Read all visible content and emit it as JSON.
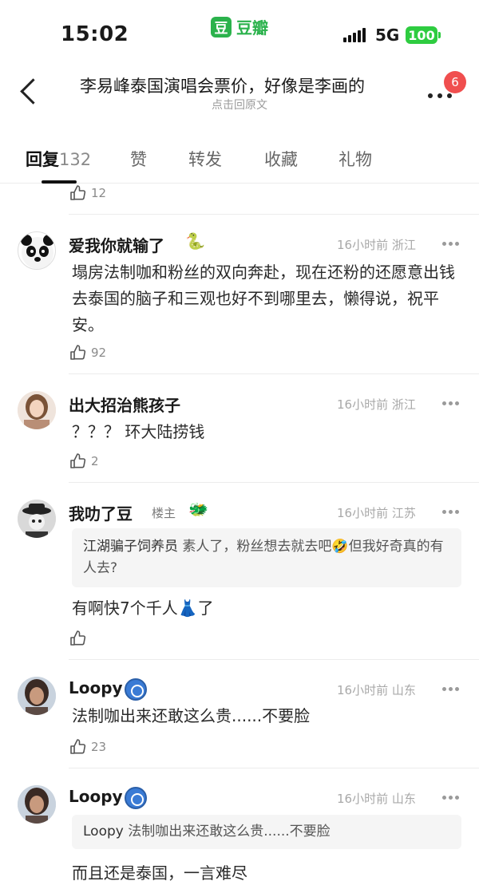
{
  "status_bar": {
    "time": "15:02",
    "app_logo_glyph": "豆",
    "app_name": "豆瓣",
    "network": "5G",
    "battery": "100"
  },
  "header": {
    "title": "李易峰泰国演唱会票价，好像是李画的",
    "subtitle": "点击回原文",
    "notification_count": "6"
  },
  "tabs": [
    {
      "label": "回复",
      "count": "132",
      "active": true
    },
    {
      "label": "赞"
    },
    {
      "label": "转发"
    },
    {
      "label": "收藏"
    },
    {
      "label": "礼物"
    }
  ],
  "prev_comment": {
    "likes": "12"
  },
  "comments": [
    {
      "username": "爱我你就输了",
      "time": "16小时前",
      "location": "浙江",
      "text": "塌房法制咖和粉丝的双向奔赴，现在还粉的还愿意出钱去泰国的脑子和三观也好不到哪里去，懒得说，祝平安。",
      "likes": "92"
    },
    {
      "username": "出大招治熊孩子",
      "time": "16小时前",
      "location": "浙江",
      "text": "？？？ 环大陆捞钱",
      "likes": "2"
    },
    {
      "username": "我叻了豆",
      "tag": "楼主",
      "time": "16小时前",
      "location": "江苏",
      "quote_user": "江湖骗子饲养员",
      "quote_text": "素人了，粉丝想去就去吧🤣但我好奇真的有人去?",
      "text": "有啊快7个千人👗了",
      "likes": ""
    },
    {
      "username": "Loopy",
      "time": "16小时前",
      "location": "山东",
      "text": "法制咖出来还敢这么贵......不要脸",
      "likes": "23"
    },
    {
      "username": "Loopy",
      "time": "16小时前",
      "location": "山东",
      "quote_user": "Loopy",
      "quote_text": "法制咖出来还敢这么贵......不要脸",
      "text": "而且还是泰国，一言难尽"
    }
  ]
}
